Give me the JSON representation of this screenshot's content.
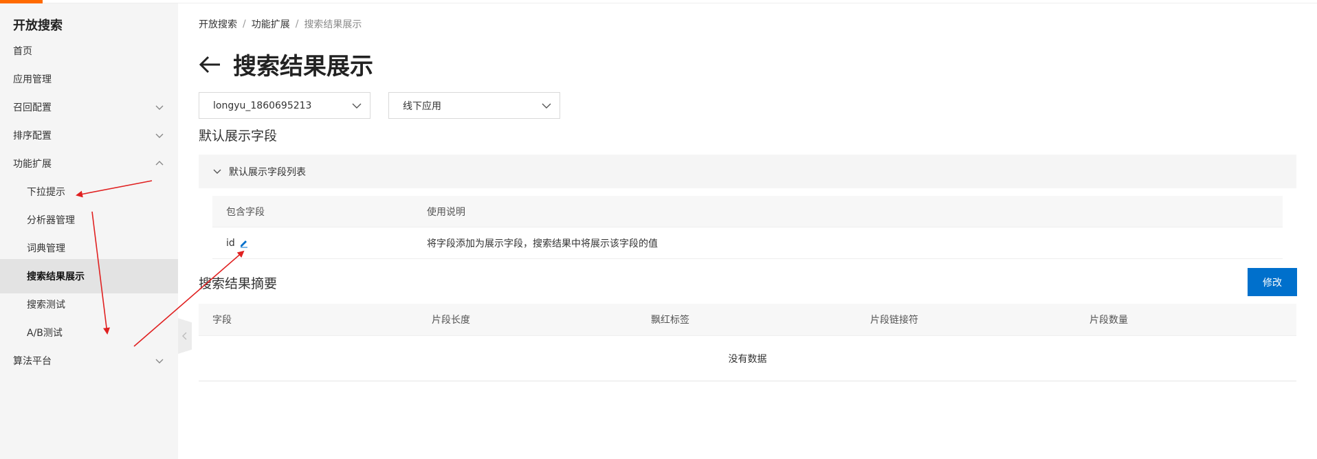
{
  "app": {
    "title": "开放搜索",
    "accent_color": "#ff6a00"
  },
  "sidebar": {
    "items": [
      {
        "label": "首页",
        "chevron": "none"
      },
      {
        "label": "应用管理",
        "chevron": "none"
      },
      {
        "label": "召回配置",
        "chevron": "chevron-down"
      },
      {
        "label": "排序配置",
        "chevron": "chevron-down"
      },
      {
        "label": "功能扩展",
        "chevron": "chevron-up"
      },
      {
        "label": "下拉提示",
        "sub": true
      },
      {
        "label": "分析器管理",
        "sub": true
      },
      {
        "label": "词典管理",
        "sub": true
      },
      {
        "label": "搜索结果展示",
        "sub": true,
        "active": true
      },
      {
        "label": "搜索测试",
        "sub": true
      },
      {
        "label": "A/B测试",
        "sub": true
      },
      {
        "label": "算法平台",
        "chevron": "chevron-down"
      }
    ]
  },
  "breadcrumb": {
    "items": [
      "开放搜索",
      "功能扩展",
      "搜索结果展示"
    ],
    "separator": "/"
  },
  "page": {
    "title": "搜索结果展示",
    "back_icon": "arrow-left-icon"
  },
  "filters": {
    "instance_select": "longyu_1860695213",
    "app_select": "线下应用"
  },
  "default_fields": {
    "section_title": "默认展示字段",
    "panel_title": "默认展示字段列表",
    "columns": [
      "包含字段",
      "使用说明"
    ],
    "rows": [
      {
        "field": "id",
        "description": "将字段添加为展示字段，搜索结果中将展示该字段的值"
      }
    ]
  },
  "summary": {
    "section_title": "搜索结果摘要",
    "modify_label": "修改",
    "columns": [
      "字段",
      "片段长度",
      "飘红标签",
      "片段链接符",
      "片段数量"
    ],
    "empty_text": "没有数据"
  },
  "colors": {
    "primary_button": "#0070cc",
    "annotation_arrow": "#e02020",
    "edit_icon": "#0070cc"
  }
}
